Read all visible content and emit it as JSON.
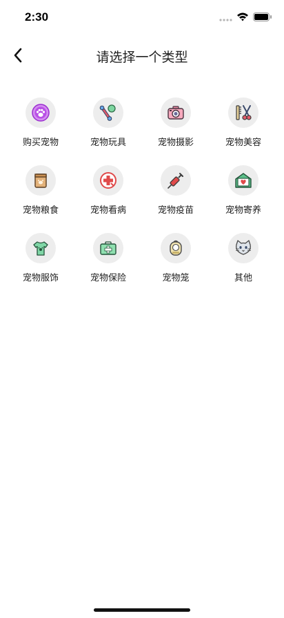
{
  "status_bar": {
    "time": "2:30"
  },
  "nav": {
    "title": "请选择一个类型"
  },
  "categories": [
    {
      "label": "购买宠物",
      "icon": "paw-icon"
    },
    {
      "label": "宠物玩具",
      "icon": "toy-bone-icon"
    },
    {
      "label": "宠物摄影",
      "icon": "camera-icon"
    },
    {
      "label": "宠物美容",
      "icon": "grooming-icon"
    },
    {
      "label": "宠物粮食",
      "icon": "food-bag-icon"
    },
    {
      "label": "宠物看病",
      "icon": "medical-icon"
    },
    {
      "label": "宠物疫苗",
      "icon": "syringe-icon"
    },
    {
      "label": "宠物寄养",
      "icon": "foster-home-icon"
    },
    {
      "label": "宠物服饰",
      "icon": "clothing-icon"
    },
    {
      "label": "宠物保险",
      "icon": "insurance-icon"
    },
    {
      "label": "宠物笼",
      "icon": "cage-icon"
    },
    {
      "label": "其他",
      "icon": "cat-face-icon"
    }
  ]
}
